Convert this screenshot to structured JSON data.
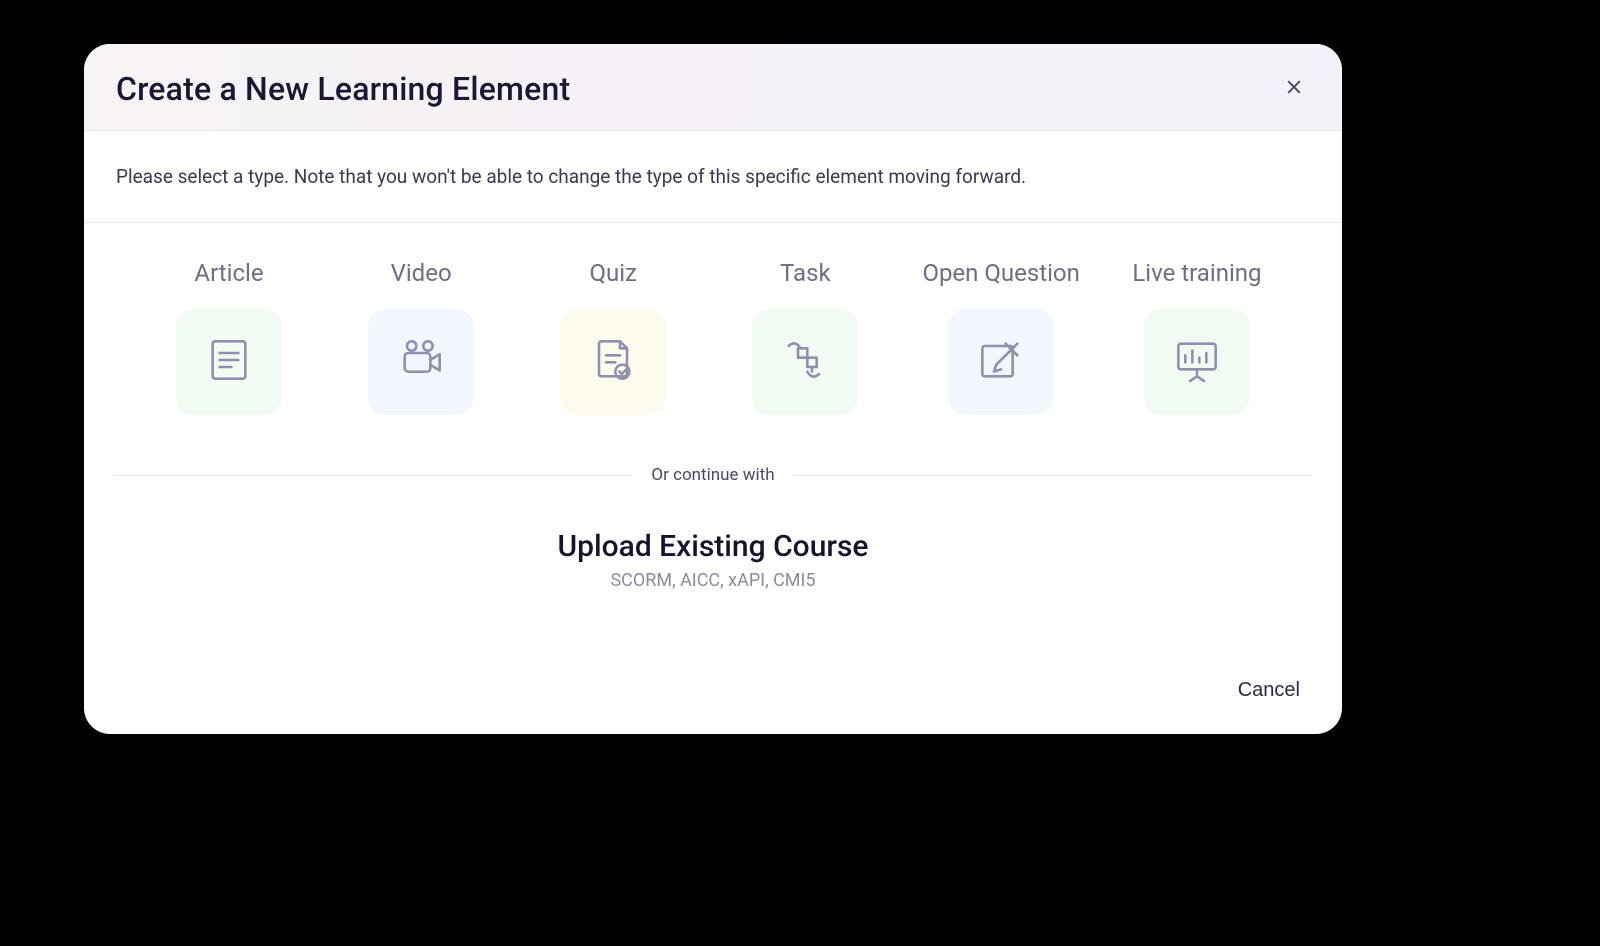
{
  "modal": {
    "title": "Create a New Learning Element",
    "instruction": "Please select a type. Note that you won't be able to change the type of this specific element moving forward.",
    "or_label": "Or continue with",
    "upload": {
      "title": "Upload Existing Course",
      "subtitle": "SCORM, AICC, xAPI, CMI5"
    },
    "cancel_label": "Cancel"
  },
  "types": [
    {
      "label": "Article",
      "icon": "article-icon",
      "tile_color": "green"
    },
    {
      "label": "Video",
      "icon": "video-icon",
      "tile_color": "blue"
    },
    {
      "label": "Quiz",
      "icon": "quiz-icon",
      "tile_color": "yellow"
    },
    {
      "label": "Task",
      "icon": "task-icon",
      "tile_color": "green"
    },
    {
      "label": "Open Question",
      "icon": "open-question-icon",
      "tile_color": "blue"
    },
    {
      "label": "Live training",
      "icon": "live-training-icon",
      "tile_color": "green"
    }
  ],
  "colors": {
    "title": "#1a1833",
    "muted": "#6f6d86",
    "icon": "#8f8fb0",
    "tile_green": "#f1faf3",
    "tile_blue": "#f2f6ff",
    "tile_yellow": "#fdfbed"
  }
}
